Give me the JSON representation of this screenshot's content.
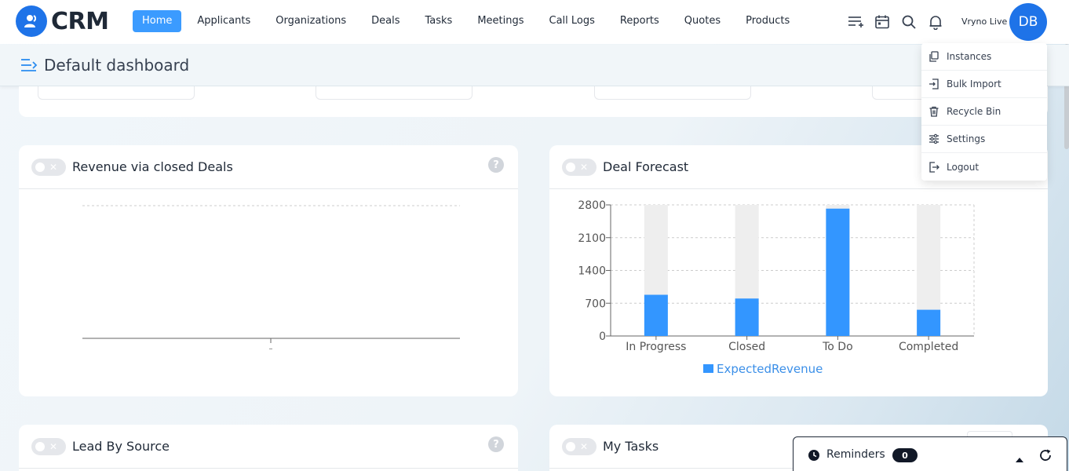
{
  "app": {
    "logo_text": "CRM"
  },
  "nav": {
    "items": [
      {
        "label": "Home",
        "active": true
      },
      {
        "label": "Applicants"
      },
      {
        "label": "Organizations"
      },
      {
        "label": "Deals"
      },
      {
        "label": "Tasks"
      },
      {
        "label": "Meetings"
      },
      {
        "label": "Call Logs"
      },
      {
        "label": "Reports"
      },
      {
        "label": "Quotes"
      },
      {
        "label": "Products"
      }
    ]
  },
  "toolbar": {
    "icons": [
      "list-add-icon",
      "calendar-icon",
      "search-icon",
      "bell-icon"
    ],
    "user_name": "Vryno Live",
    "avatar_initials": "DB"
  },
  "dashboard": {
    "title": "Default dashboard"
  },
  "user_menu": {
    "items": [
      {
        "label": "Instances",
        "icon": "copy-icon"
      },
      {
        "label": "Bulk Import",
        "icon": "import-icon"
      },
      {
        "label": "Recycle Bin",
        "icon": "trash-icon"
      },
      {
        "label": "Settings",
        "icon": "sliders-icon"
      },
      {
        "label": "Logout",
        "icon": "logout-icon"
      }
    ]
  },
  "widgets": {
    "revenue": {
      "title": "Revenue via closed Deals",
      "x_tick": "–"
    },
    "forecast": {
      "title": "Deal Forecast"
    },
    "lead_source": {
      "title": "Lead By Source"
    },
    "my_tasks": {
      "title": "My Tasks"
    }
  },
  "reminders": {
    "label": "Reminders",
    "count": "0"
  },
  "colors": {
    "accent": "#1e73e8",
    "bar": "#3396ff",
    "bar_bg": "#eeeeee",
    "nav_active": "#3b9bff"
  },
  "chart_data": [
    {
      "type": "line",
      "title": "Revenue via closed Deals",
      "categories": [
        "–"
      ],
      "series": [],
      "grid": true
    },
    {
      "type": "bar",
      "title": "Deal Forecast",
      "categories": [
        "In Progress",
        "Closed",
        "To Do",
        "Completed"
      ],
      "series": [
        {
          "name": "ExpectedRevenue",
          "values": [
            880,
            800,
            2720,
            560
          ]
        }
      ],
      "background_max": 2800,
      "ylim": [
        0,
        2800
      ],
      "yticks": [
        0,
        700,
        1400,
        2100,
        2800
      ],
      "legend": "bottom",
      "grid": true
    }
  ]
}
